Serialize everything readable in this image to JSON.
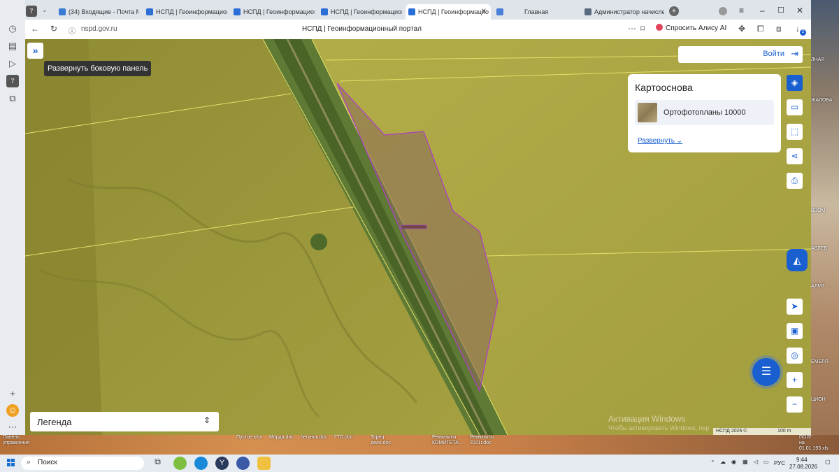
{
  "browser": {
    "tabs": [
      {
        "label": "(34) Входящие - Почта М"
      },
      {
        "label": "НСПД | Геоинформацион"
      },
      {
        "label": "НСПД | Геоинформацион"
      },
      {
        "label": "НСПД | Геоинформацион"
      },
      {
        "label": "НСПД | Геоинформацио",
        "active": true
      },
      {
        "label": "Главная"
      },
      {
        "label": "Администратор начисле"
      }
    ],
    "tab_counter": "7",
    "rail_counter": "7",
    "url": "nspd.gov.ru",
    "page_title": "НСПД | Геоинформационный портал",
    "alisa_label": "Спросить Алису AI",
    "download_badge": "2"
  },
  "map": {
    "expand_tooltip": "Развернуть боковую панель",
    "login_label": "Войти",
    "basemap_panel": {
      "title": "Картооснова",
      "layer": "Ортофотопланы 10000",
      "expand_link": "Развернуть"
    },
    "legend_label": "Легенда",
    "watermark_title": "Активация Windows",
    "watermark_sub": "Чтобы активировать Windows, пер",
    "attribution": "НСПД 2026 ©",
    "scale": "100 m",
    "colors": {
      "accent": "#1a5fd0",
      "parcel_outline": "#b03cc8",
      "field_tint": "#a8a23a"
    }
  },
  "desktop": {
    "icons": [
      {
        "label": "Панель\nуправления"
      },
      {
        "label": "Пустое.xlsx"
      },
      {
        "label": "Морда.doc"
      },
      {
        "label": "бегунок.doc"
      },
      {
        "label": "ГТО.doc"
      },
      {
        "label": "Торец\nдело.doc"
      },
      {
        "label": "Реквизиты\nКОМИТЕТА..."
      },
      {
        "label": "Реквизиты\n2021г.doc"
      }
    ],
    "right_labels": [
      "ЛНАЯ",
      "ЖАЛОБА",
      "ВВОМ",
      "АВЛЕВ",
      "АЛМ7",
      "ЕМЕЛЯ",
      "ЦИОН",
      "ПОЛГ\nна\n01.01.193.xls"
    ]
  },
  "taskbar": {
    "search_label": "Поиск",
    "lang": "РУС",
    "time": "9:44",
    "date": "27.08.2026"
  }
}
